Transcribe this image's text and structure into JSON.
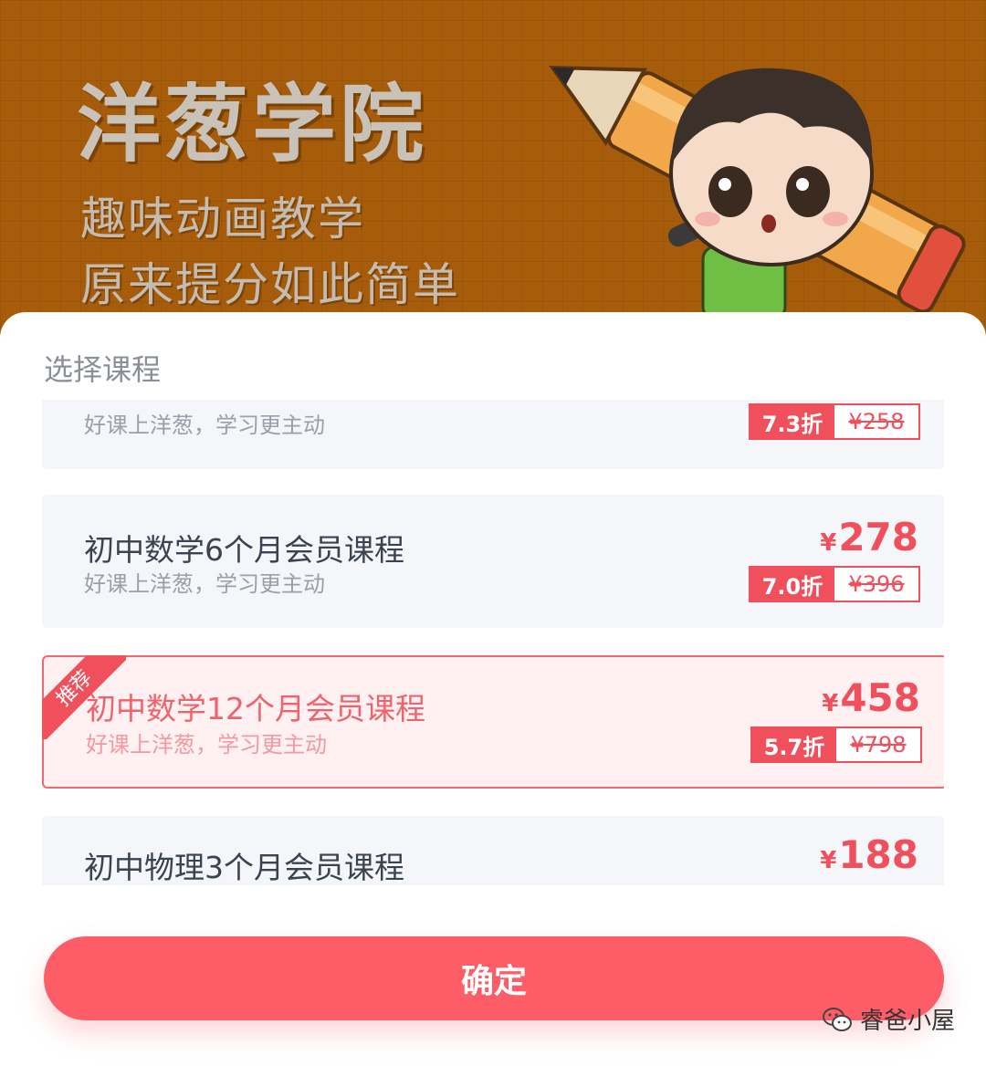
{
  "banner": {
    "title": "洋葱学院",
    "subtitle1": "趣味动画教学",
    "subtitle2": "原来提分如此简单"
  },
  "sheet": {
    "title": "选择课程"
  },
  "courses": [
    {
      "name": "",
      "desc": "好课上洋葱，学习更主动",
      "price": "",
      "discount": "7.3折",
      "original": "¥258"
    },
    {
      "name": "初中数学6个月会员课程",
      "desc": "好课上洋葱，学习更主动",
      "price": "278",
      "discount": "7.0折",
      "original": "¥396"
    },
    {
      "name": "初中数学12个月会员课程",
      "desc": "好课上洋葱，学习更主动",
      "price": "458",
      "discount": "5.7折",
      "original": "¥798",
      "badge": "推荐",
      "selected": true
    },
    {
      "name": "初中物理3个月会员课程",
      "desc": "",
      "price": "188",
      "discount": "",
      "original": ""
    }
  ],
  "currency": "¥",
  "confirm_label": "确定",
  "watermark": {
    "text": "睿爸小屋",
    "icon": "wechat-icon"
  },
  "colors": {
    "accent": "#f0505c",
    "button": "#fd5d67",
    "banner": "#b5650c"
  }
}
